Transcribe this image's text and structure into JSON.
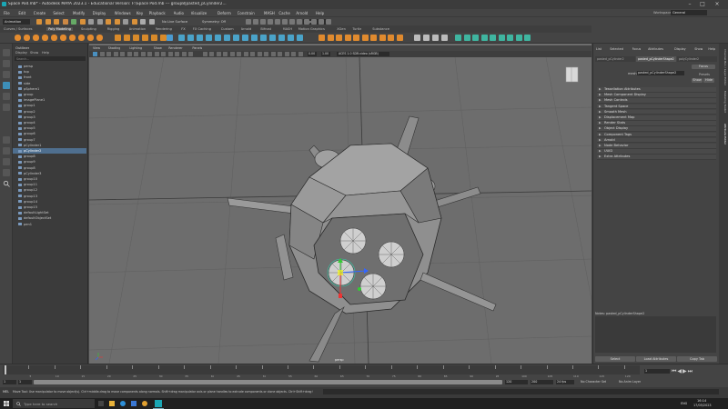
{
  "window": {
    "title": "Space Pod.mb* - Autodesk MAYA 2023.1 - Educational Version: F:\\Space Pod.mb  ---  group8|pasted_pCylinder2...",
    "workspace_label": "Workspace:",
    "workspace_value": "General"
  },
  "menus": [
    "File",
    "Edit",
    "Create",
    "Select",
    "Modify",
    "Display",
    "Windows",
    "Key",
    "Playback",
    "Audio",
    "Visualize",
    "Deform",
    "Constrain",
    "MASH",
    "Cache",
    "Arnold",
    "Help"
  ],
  "statusline": {
    "menuset": "Animation",
    "live_surface": "No Live Surface",
    "symmetry": "Symmetry: Off",
    "signin": "Sign In"
  },
  "shelf_tabs": [
    "Curves / Surfaces",
    "Poly Modeling",
    "Sculpting",
    "Rigging",
    "Animation",
    "Rendering",
    "FX",
    "FX Caching",
    "Custom",
    "Arnold",
    "Bifrost",
    "MASH",
    "Motion Graphics",
    "XGen",
    "Turtle",
    "Substance"
  ],
  "outliner": {
    "title": "Outliner",
    "menu": [
      "Display",
      "Show",
      "Help"
    ],
    "search_placeholder": "Search...",
    "items": [
      {
        "label": "persp",
        "selected": false
      },
      {
        "label": "top",
        "selected": false
      },
      {
        "label": "front",
        "selected": false
      },
      {
        "label": "side",
        "selected": false
      },
      {
        "label": "pSphere1",
        "selected": false
      },
      {
        "label": "group",
        "selected": false
      },
      {
        "label": "imagePlane1",
        "selected": false
      },
      {
        "label": "group1",
        "selected": false
      },
      {
        "label": "group2",
        "selected": false
      },
      {
        "label": "group3",
        "selected": false
      },
      {
        "label": "group4",
        "selected": false
      },
      {
        "label": "group5",
        "selected": false
      },
      {
        "label": "group6",
        "selected": false
      },
      {
        "label": "group7",
        "selected": false
      },
      {
        "label": "pCylinder1",
        "selected": false
      },
      {
        "label": "pCylinder2",
        "selected": true
      },
      {
        "label": "group8",
        "selected": false
      },
      {
        "label": "group9",
        "selected": false
      },
      {
        "label": "group8",
        "selected": false
      },
      {
        "label": "pCylinder3",
        "selected": false
      },
      {
        "label": "group10",
        "selected": false
      },
      {
        "label": "group11",
        "selected": false
      },
      {
        "label": "group12",
        "selected": false
      },
      {
        "label": "group13",
        "selected": false
      },
      {
        "label": "group14",
        "selected": false
      },
      {
        "label": "group15",
        "selected": false
      },
      {
        "label": "defaultLightSet",
        "selected": false
      },
      {
        "label": "defaultObjectSet",
        "selected": false
      },
      {
        "label": "pen1",
        "selected": false
      }
    ]
  },
  "viewport": {
    "menu": [
      "View",
      "Shading",
      "Lighting",
      "Show",
      "Renderer",
      "Panels"
    ],
    "camera_label": "persp",
    "gamma_value": "1.00",
    "exposure_value": "0.00",
    "colorspace": "ACES 1.0 SDR-video (sRGB)"
  },
  "attribute_editor": {
    "menu": [
      "List",
      "Selected",
      "Focus",
      "Attributes",
      "Display",
      "Show",
      "Help"
    ],
    "tabs": [
      "pasted_pCylinder2",
      "pasted_pCylinderShape2",
      "polyCylinder2"
    ],
    "node_label": "mesh:",
    "node_value": "pasted_pCylinderShape2",
    "focus_button": "Focus",
    "presets_button": "Presets",
    "show_button": "Show",
    "hide_button": "Hide",
    "sections": [
      "Tessellation Attributes",
      "Mesh Component Display",
      "Mesh Controls",
      "Tangent Space",
      "Smooth Mesh",
      "Displacement Map",
      "Render Stats",
      "Object Display",
      "Component Tags",
      "Arnold",
      "Node Behavior",
      "UUID",
      "Extra Attributes"
    ],
    "notes_label": "Notes: pasted_pCylinderShape2",
    "bottom_buttons": [
      "Select",
      "Load Attributes",
      "Copy Tab"
    ]
  },
  "side_tabs": [
    "Channel Box / Layer Editor",
    "Modeling Toolkit",
    "Attribute Editor"
  ],
  "timeline": {
    "ticks": [
      "5",
      "10",
      "15",
      "20",
      "25",
      "30",
      "35",
      "40",
      "45",
      "50",
      "55",
      "60",
      "65",
      "70",
      "75",
      "80",
      "85",
      "90",
      "95",
      "100",
      "105",
      "110",
      "115",
      "120"
    ],
    "current_frame": "1",
    "range_start": "1",
    "range_inner_start": "1",
    "range_inner_end": "120",
    "range_end": "120",
    "range_end2": "200",
    "fps": "24 fps",
    "char_set": "No Character Set",
    "anim_layer": "No Anim Layer"
  },
  "helpline": {
    "mel": "MEL",
    "text": "Move Tool: Use manipulator to move object(s). Ctrl+middle-drag to move components along normals. Shift+drag manipulator axis or plane handles to extrude components or clone objects. Ctrl+Shift+drag to constrain movement to a connected edge. Use D or INSERT to change the pivot position and axis orientation."
  },
  "taskbar": {
    "search_placeholder": "Type here to search",
    "time": "16:14",
    "date": "17/05/2023",
    "language": "ENG"
  },
  "colors": {
    "viewport_bg": "#6d6d6d",
    "selection": "#4f6f8f",
    "manip_x": "#e33",
    "manip_y": "#3c3",
    "manip_z": "#36f"
  }
}
